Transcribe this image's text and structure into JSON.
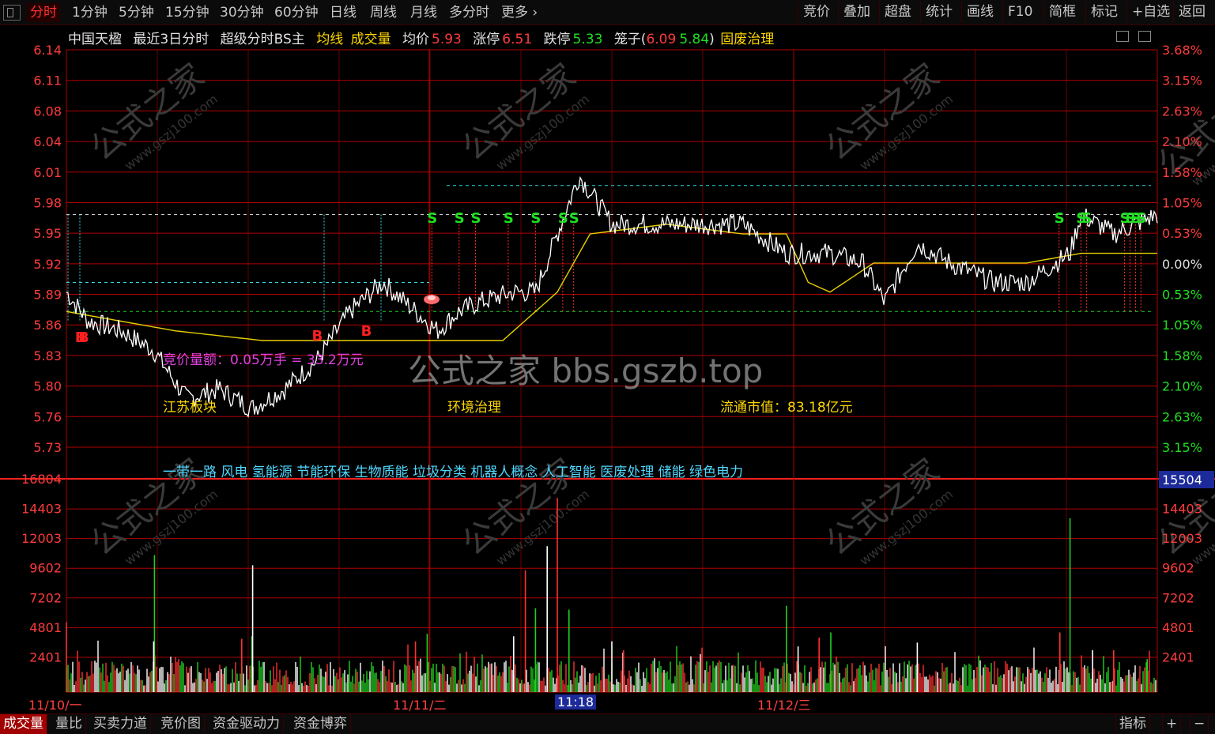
{
  "toolbar": {
    "period_tabs": [
      "分时",
      "1分钟",
      "5分钟",
      "15分钟",
      "30分钟",
      "60分钟",
      "日线",
      "周线",
      "月线",
      "多分时",
      "更多"
    ],
    "right_buttons": [
      "竞价",
      "叠加",
      "超盘",
      "统计",
      "画线",
      "F10",
      "简框",
      "标记",
      "+自选",
      "返回"
    ]
  },
  "info": {
    "stock_name": "中国天楹",
    "mode": "最近3日分时",
    "indicator": "超级分时BS主",
    "avg_line_label": "均线",
    "volume_label": "成交量",
    "avg_price_label": "均价",
    "avg_price": "5.93",
    "limit_up_label": "涨停",
    "limit_up": "6.51",
    "limit_down_label": "跌停",
    "limit_down": "5.33",
    "cage_label": "笼子(",
    "cage_high": "6.09",
    "cage_low": "5.84",
    "cage_close": ")",
    "sector": "固废治理"
  },
  "price_axis": {
    "left": [
      "6.14",
      "6.11",
      "6.08",
      "6.04",
      "6.01",
      "5.98",
      "5.95",
      "5.92",
      "5.89",
      "5.86",
      "5.83",
      "5.80",
      "5.76",
      "5.73"
    ],
    "right": [
      "3.68%",
      "3.15%",
      "2.63%",
      "2.10%",
      "1.58%",
      "1.05%",
      "0.53%",
      "0.00%",
      "0.53%",
      "1.05%",
      "1.58%",
      "2.10%",
      "2.63%",
      "3.15%"
    ]
  },
  "volume_axis": {
    "left": [
      "16804",
      "14403",
      "12003",
      "9602",
      "7202",
      "4801",
      "2401"
    ],
    "right": [
      "15504",
      "14403",
      "12003",
      "9602",
      "7202",
      "4801",
      "2401"
    ]
  },
  "chart_labels": {
    "auction_amount": "竞价量额：0.05万手 = 33.2万元",
    "region": "江苏板块",
    "theme": "环境治理",
    "float_cap": "流通市值：83.18亿元",
    "concepts": "一带一路 风电 氢能源 节能环保 生物质能 垃圾分类 机器人概念 人工智能 医废处理 储能 绿色电力",
    "watermark": "公式之家 bbs.gszb.top",
    "watermark_diag": "公式之家",
    "watermark_url": "www.gszj100.com"
  },
  "signals": {
    "buy": "B",
    "sell": "S"
  },
  "time_axis": {
    "day1": "11/10/一",
    "day2": "11/11/二",
    "cursor": "11:18",
    "day3": "11/12/三"
  },
  "bottom_tabs": [
    "成交量",
    "量比",
    "买卖力道",
    "竞价图",
    "资金驱动力",
    "资金博弈"
  ],
  "bottom_right": [
    "指标",
    "+",
    "−"
  ],
  "colors": {
    "grid": "#b00000",
    "price_line": "#ffffff",
    "avg_line": "#e8d000",
    "up_volume": "#ff3030",
    "down_volume": "#20d020",
    "flat_volume": "#ffffff",
    "buy_signal": "#ff2020",
    "sell_signal": "#20e020",
    "cyan_level": "#33d6e0"
  },
  "chart_data": {
    "type": "line",
    "title": "中国天楹 最近3日分时",
    "days": [
      "11/10",
      "11/11",
      "11/12"
    ],
    "prev_close": 5.92,
    "ylim_price": [
      5.73,
      6.14
    ],
    "ylim_volume": [
      0,
      16804
    ],
    "levels": {
      "cyan_top": 6.0,
      "white_dash": 5.97,
      "cyan_mid": 5.9,
      "green_bottom": 5.87
    },
    "price_keypoints": [
      {
        "x": 0.0,
        "y": 5.89
      },
      {
        "x": 0.02,
        "y": 5.86
      },
      {
        "x": 0.05,
        "y": 5.85
      },
      {
        "x": 0.08,
        "y": 5.83
      },
      {
        "x": 0.11,
        "y": 5.78
      },
      {
        "x": 0.14,
        "y": 5.79
      },
      {
        "x": 0.17,
        "y": 5.77
      },
      {
        "x": 0.2,
        "y": 5.79
      },
      {
        "x": 0.23,
        "y": 5.82
      },
      {
        "x": 0.26,
        "y": 5.87
      },
      {
        "x": 0.29,
        "y": 5.9
      },
      {
        "x": 0.31,
        "y": 5.88
      },
      {
        "x": 0.34,
        "y": 5.85
      },
      {
        "x": 0.36,
        "y": 5.87
      },
      {
        "x": 0.38,
        "y": 5.88
      },
      {
        "x": 0.41,
        "y": 5.89
      },
      {
        "x": 0.43,
        "y": 5.89
      },
      {
        "x": 0.45,
        "y": 5.95
      },
      {
        "x": 0.47,
        "y": 6.01
      },
      {
        "x": 0.5,
        "y": 5.96
      },
      {
        "x": 0.54,
        "y": 5.96
      },
      {
        "x": 0.58,
        "y": 5.96
      },
      {
        "x": 0.62,
        "y": 5.96
      },
      {
        "x": 0.66,
        "y": 5.93
      },
      {
        "x": 0.7,
        "y": 5.93
      },
      {
        "x": 0.73,
        "y": 5.92
      },
      {
        "x": 0.75,
        "y": 5.88
      },
      {
        "x": 0.78,
        "y": 5.94
      },
      {
        "x": 0.81,
        "y": 5.92
      },
      {
        "x": 0.85,
        "y": 5.9
      },
      {
        "x": 0.88,
        "y": 5.9
      },
      {
        "x": 0.92,
        "y": 5.93
      },
      {
        "x": 0.93,
        "y": 5.97
      },
      {
        "x": 0.96,
        "y": 5.95
      },
      {
        "x": 1.0,
        "y": 5.97
      }
    ],
    "avg_keypoints": [
      {
        "x": 0.0,
        "y": 5.87
      },
      {
        "x": 0.1,
        "y": 5.85
      },
      {
        "x": 0.18,
        "y": 5.84
      },
      {
        "x": 0.25,
        "y": 5.84
      },
      {
        "x": 0.33,
        "y": 5.84
      },
      {
        "x": 0.4,
        "y": 5.84
      },
      {
        "x": 0.45,
        "y": 5.89
      },
      {
        "x": 0.48,
        "y": 5.95
      },
      {
        "x": 0.55,
        "y": 5.96
      },
      {
        "x": 0.62,
        "y": 5.95
      },
      {
        "x": 0.66,
        "y": 5.95
      },
      {
        "x": 0.68,
        "y": 5.9
      },
      {
        "x": 0.7,
        "y": 5.89
      },
      {
        "x": 0.74,
        "y": 5.92
      },
      {
        "x": 0.8,
        "y": 5.92
      },
      {
        "x": 0.88,
        "y": 5.92
      },
      {
        "x": 0.93,
        "y": 5.93
      },
      {
        "x": 1.0,
        "y": 5.93
      }
    ],
    "volume_spikes": [
      {
        "x": 0.0,
        "v": 5500
      },
      {
        "x": 0.08,
        "v": 10800
      },
      {
        "x": 0.08,
        "v": 4000
      },
      {
        "x": 0.16,
        "v": 4200
      },
      {
        "x": 0.17,
        "v": 4400
      },
      {
        "x": 0.17,
        "v": 10000
      },
      {
        "x": 0.32,
        "v": 4000
      },
      {
        "x": 0.33,
        "v": 4600
      },
      {
        "x": 0.41,
        "v": 4400
      },
      {
        "x": 0.42,
        "v": 9600
      },
      {
        "x": 0.43,
        "v": 6600
      },
      {
        "x": 0.44,
        "v": 11500
      },
      {
        "x": 0.45,
        "v": 15300
      },
      {
        "x": 0.46,
        "v": 6500
      },
      {
        "x": 0.5,
        "v": 4000
      },
      {
        "x": 0.51,
        "v": 3300
      },
      {
        "x": 0.66,
        "v": 6800
      },
      {
        "x": 0.67,
        "v": 3600
      },
      {
        "x": 0.69,
        "v": 4300
      },
      {
        "x": 0.7,
        "v": 4700
      },
      {
        "x": 0.78,
        "v": 3900
      },
      {
        "x": 0.91,
        "v": 4700
      },
      {
        "x": 0.92,
        "v": 13700
      },
      {
        "x": 0.94,
        "v": 3300
      },
      {
        "x": 0.96,
        "v": 3300
      },
      {
        "x": 0.99,
        "v": 2600
      }
    ],
    "buy_signals": [
      0.005,
      0.008,
      0.225,
      0.27
    ],
    "sell_signals": [
      0.335,
      0.36,
      0.375,
      0.405,
      0.43,
      0.455,
      0.465,
      0.91,
      0.93,
      0.935,
      0.97,
      0.975,
      0.98,
      0.985
    ]
  }
}
